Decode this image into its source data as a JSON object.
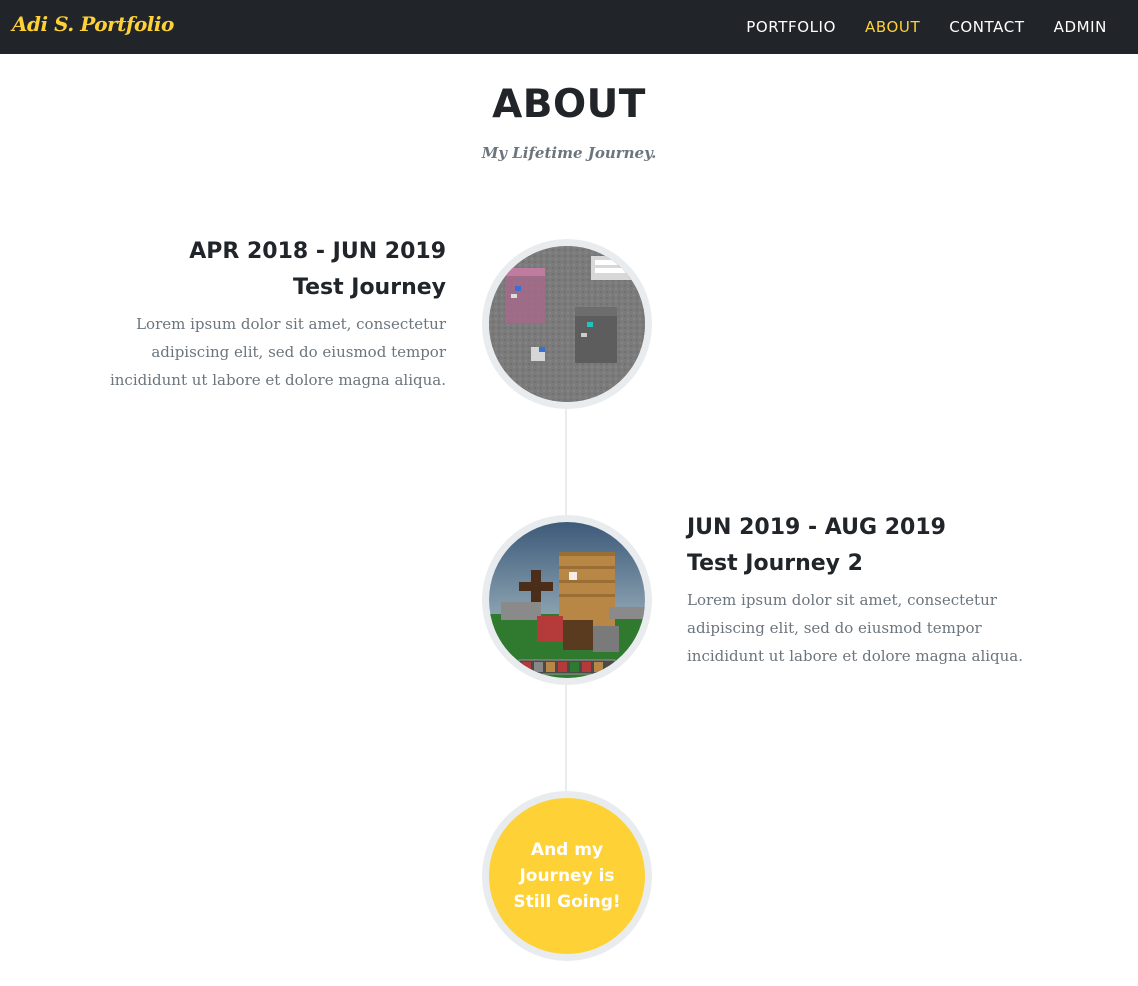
{
  "navbar": {
    "brand": "Adi S. Portfolio",
    "links": [
      {
        "label": "PORTFOLIO",
        "active": false
      },
      {
        "label": "ABOUT",
        "active": true
      },
      {
        "label": "CONTACT",
        "active": false
      },
      {
        "label": "ADMIN",
        "active": false
      }
    ]
  },
  "header": {
    "title": "ABOUT",
    "subtitle": "My Lifetime Journey."
  },
  "timeline": {
    "entries": [
      {
        "date": "APR 2018 - JUN 2019",
        "title": "Test Journey",
        "description": "Lorem ipsum dolor sit amet, consectetur adipiscing elit, sed do eiusmod tempor incididunt ut labore et dolore magna aliqua.",
        "image": "app-screenshot-thumbnail",
        "side": "left"
      },
      {
        "date": "JUN 2019 - AUG 2019",
        "title": "Test Journey 2",
        "description": "Lorem ipsum dolor sit amet, consectetur adipiscing elit, sed do eiusmod tempor incididunt ut labore et dolore magna aliqua.",
        "image": "game-screenshot-thumbnail",
        "side": "right"
      }
    ],
    "end_message": "And my Journey is Still Going!"
  },
  "colors": {
    "accent": "#fed136",
    "navbar_bg": "#212529",
    "heading": "#212529",
    "muted": "#6c757d",
    "timeline_line": "#e9ecef"
  }
}
